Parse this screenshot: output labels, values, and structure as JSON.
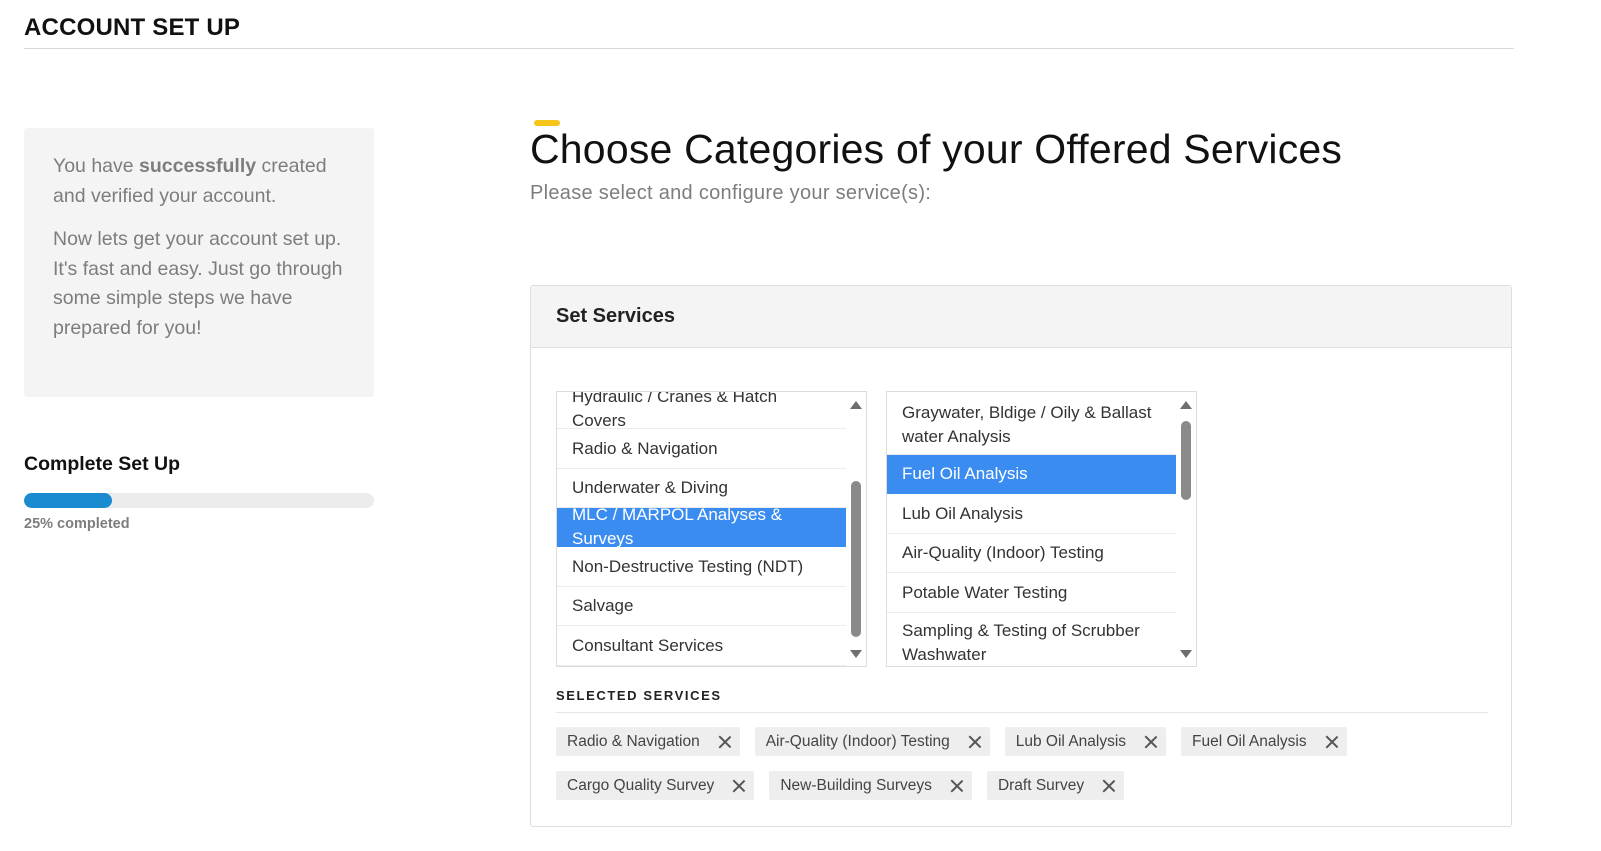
{
  "page": {
    "title": "ACCOUNT SET UP"
  },
  "intro": {
    "line1_prefix": "You have ",
    "line1_bold": "successfully",
    "line1_suffix": " created and verified your account.",
    "line2": "Now lets get your account set up. It's fast and easy. Just go through some simple steps we have prepared for you!"
  },
  "progress": {
    "title": "Complete Set Up",
    "percent": 25,
    "label": "25% completed",
    "color": "#1a8bd0"
  },
  "main": {
    "heading": "Choose Categories of your Offered Services",
    "subheading": "Please select and configure your service(s):",
    "accent_color": "#f5c518"
  },
  "panel": {
    "title": "Set Services"
  },
  "categories": {
    "items": [
      {
        "label": "Hydraulic / Cranes & Hatch Covers",
        "selected": false
      },
      {
        "label": "Radio & Navigation",
        "selected": false
      },
      {
        "label": "Underwater & Diving",
        "selected": false
      },
      {
        "label": "MLC / MARPOL Analyses & Surveys",
        "selected": true
      },
      {
        "label": "Non-Destructive Testing (NDT)",
        "selected": false
      },
      {
        "label": "Salvage",
        "selected": false
      },
      {
        "label": "Consultant Services",
        "selected": false
      }
    ]
  },
  "subservices": {
    "items": [
      {
        "label": "Graywater, Bldige / Oily & Ballast water Analysis",
        "selected": false
      },
      {
        "label": "Fuel Oil Analysis",
        "selected": true
      },
      {
        "label": "Lub Oil Analysis",
        "selected": false
      },
      {
        "label": "Air-Quality (Indoor) Testing",
        "selected": false
      },
      {
        "label": "Potable Water Testing",
        "selected": false
      },
      {
        "label": "Sampling & Testing of Scrubber Washwater",
        "selected": false
      }
    ]
  },
  "selected_services": {
    "label": "SELECTED SERVICES",
    "row1": [
      {
        "label": "Radio & Navigation"
      },
      {
        "label": "Air-Quality (Indoor) Testing"
      },
      {
        "label": "Lub Oil Analysis"
      },
      {
        "label": "Fuel Oil Analysis"
      }
    ],
    "row2": [
      {
        "label": "Cargo Quality Survey"
      },
      {
        "label": "New-Building Surveys"
      },
      {
        "label": "Draft Survey"
      }
    ]
  },
  "colors": {
    "selection": "#3b8cf0"
  }
}
